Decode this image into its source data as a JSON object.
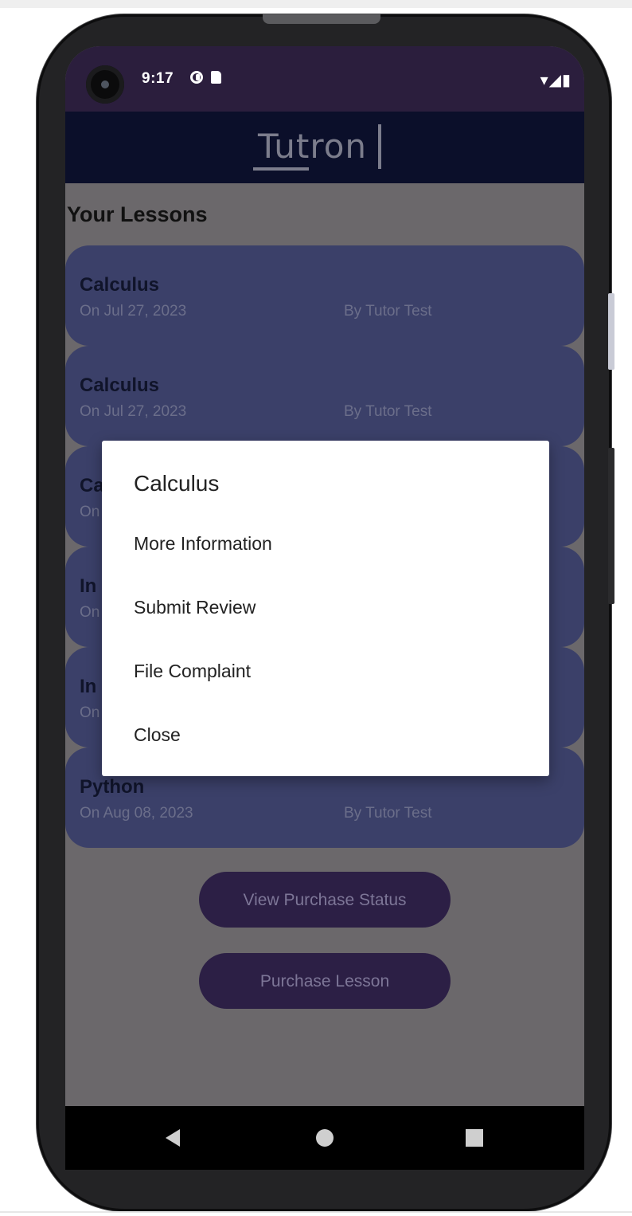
{
  "status": {
    "time": "9:17",
    "right_icons": "▾◢▮"
  },
  "app": {
    "logo": "Tutron"
  },
  "lessons_screen": {
    "heading": "Your Lessons",
    "lessons": [
      {
        "subject": "Calculus",
        "date": "On Jul 27, 2023",
        "tutor": "By Tutor Test"
      },
      {
        "subject": "Calculus",
        "date": "On Jul 27, 2023",
        "tutor": "By Tutor Test"
      },
      {
        "subject": "Ca",
        "date": "On",
        "tutor": ""
      },
      {
        "subject": "In",
        "date": "On",
        "tutor": ""
      },
      {
        "subject": "In",
        "date": "On",
        "tutor": ""
      },
      {
        "subject": "Python",
        "date": "On Aug 08, 2023",
        "tutor": "By Tutor Test"
      }
    ],
    "view_status_label": "View Purchase Status",
    "purchase_label": "Purchase Lesson"
  },
  "dialog": {
    "title": "Calculus",
    "items": [
      "More Information",
      "Submit Review",
      "File Complaint",
      "Close"
    ]
  },
  "colors": {
    "status_bar": "#2b1e3d",
    "app_bar": "#0b0f2a",
    "card": "#3b4069",
    "button": "#2c1f45",
    "scrim_background": "#6b686b"
  }
}
